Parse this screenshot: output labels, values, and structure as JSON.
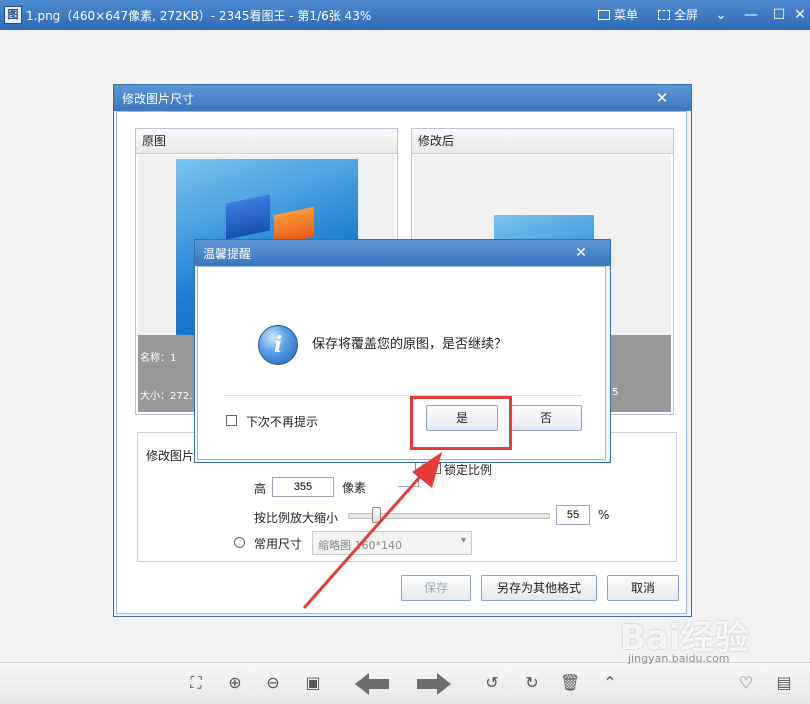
{
  "window": {
    "title": "1.png（460×647像素, 272KB）- 2345看图王 - 第1/6张 43%",
    "menu_label": "菜单",
    "fullscreen_label": "全屏",
    "app_icon_char": "图"
  },
  "resize_dialog": {
    "title": "修改图片尺寸",
    "original_panel": {
      "title": "原图",
      "name_label": "名称：1",
      "size_label": "大小：272."
    },
    "modified_panel": {
      "title": "修改后",
      "size_label": "5"
    },
    "settings": {
      "group_label": "修改图片",
      "height_label": "高",
      "height_value": "355",
      "unit_pixels": "像素",
      "lock_ratio_label": "锁定比例",
      "lock_ratio_checked": true,
      "scale_label": "按比例放大缩小",
      "scale_value": "55",
      "scale_percent": 55,
      "percent_sign": "%",
      "common_size_label": "常用尺寸",
      "common_size_value": "缩略图 160*140"
    },
    "buttons": {
      "save": "保存",
      "save_as": "另存为其他格式",
      "cancel": "取消"
    }
  },
  "alert_dialog": {
    "title": "温馨提醒",
    "message": "保存将覆盖您的原图，是否继续？",
    "dont_show_label": "下次不再提示",
    "yes_label": "是",
    "no_label": "否"
  },
  "watermark": {
    "text": "Bai经验",
    "sub": "jingyan.baidu.com"
  },
  "colors": {
    "titlebar": "#3c76be",
    "highlight": "#e53b3b"
  }
}
